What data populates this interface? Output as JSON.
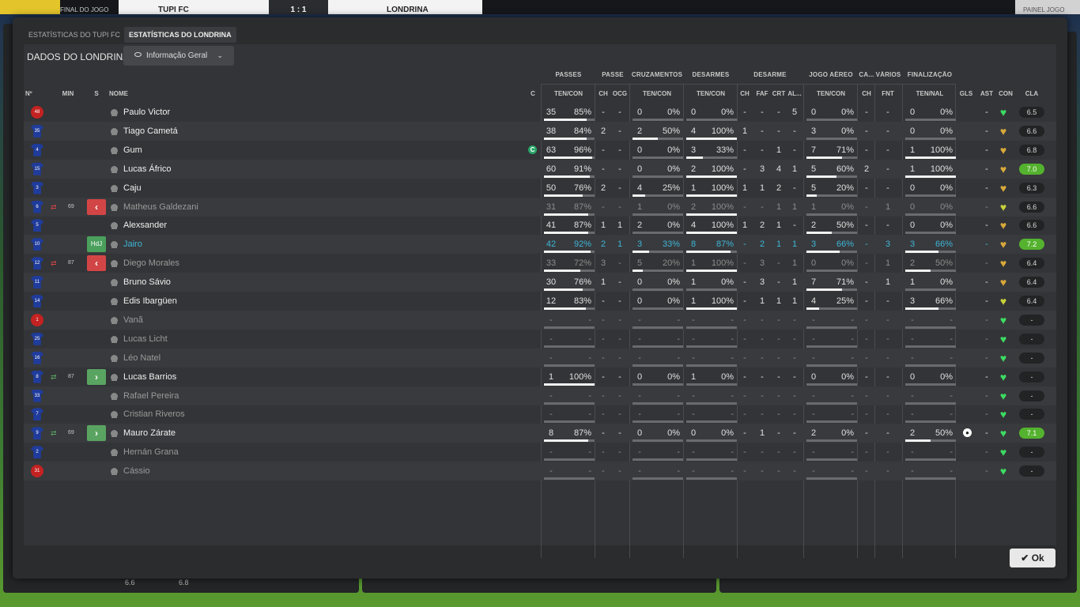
{
  "topbar": {
    "competition_label": "FINAL DO JOGO",
    "home_team": "TUPI FC",
    "score": "1 : 1",
    "away_team": "LONDRINA",
    "right_label": "PAINEL JOGO"
  },
  "tabs": [
    {
      "label": "Estatísticas do Tupi FC"
    },
    {
      "label": "Estatísticas do Londrina"
    }
  ],
  "section_title": "DADOS DO LONDRINA",
  "view_dropdown": {
    "label": "Informação Geral"
  },
  "group_headers": {
    "passes": "PASSES",
    "passe": "PASSE",
    "cruzamentos": "CRUZAMENTOS",
    "desarmes": "DESARMES",
    "desarme": "DESARME",
    "jogo_aereo": "JOGO AÉREO",
    "ca": "CA...",
    "varios": "VÁRIOS",
    "finalizacao": "FINALIZAÇÃO"
  },
  "columns": {
    "num": "Nº",
    "min": "MIN",
    "s": "S",
    "nome": "NOME",
    "c": "C",
    "passes": "TEN/CON",
    "passe_ch": "CH",
    "passe_ocg": "OCG",
    "cruz": "TEN/CON",
    "desarmes": "TEN/CON",
    "des_ch": "CH",
    "des_faf": "FAF",
    "des_crt": "CRT",
    "des_al": "AL...",
    "aereo": "TEN/CON",
    "ca_ch": "CH",
    "fnt": "FNT",
    "finalizacao": "TEN/NAL",
    "gls": "GLS",
    "ast": "AST",
    "con": "CON",
    "cla": "CLA"
  },
  "players": [
    {
      "num": "48",
      "kit": "gk",
      "sub_icon": "",
      "min": "",
      "badge": "",
      "badge_text": "",
      "name": "Paulo Victor",
      "style": "",
      "cap": "",
      "pt": "35",
      "pp": "85%",
      "pf": 0.85,
      "pch": "-",
      "ocg": "-",
      "ct": "0",
      "cp": "0%",
      "cf": 0,
      "dt": "0",
      "dp": "0%",
      "df": 0,
      "dch": "-",
      "faf": "-",
      "crt": "-",
      "al": "5",
      "at": "0",
      "ap": "0%",
      "af": 0,
      "cach": "-",
      "fnt": "-",
      "ft": "0",
      "fp": "0%",
      "ff": 0,
      "gls": "",
      "ast": "-",
      "con": "green",
      "cla": "6.5",
      "cla_style": ""
    },
    {
      "num": "35",
      "kit": "blue",
      "sub_icon": "",
      "min": "",
      "badge": "",
      "badge_text": "",
      "name": "Tiago Cametá",
      "style": "",
      "cap": "",
      "pt": "38",
      "pp": "84%",
      "pf": 0.84,
      "pch": "2",
      "ocg": "-",
      "ct": "2",
      "cp": "50%",
      "cf": 0.5,
      "dt": "4",
      "dp": "100%",
      "df": 1,
      "dch": "1",
      "faf": "-",
      "crt": "-",
      "al": "-",
      "at": "3",
      "ap": "0%",
      "af": 0,
      "cach": "-",
      "fnt": "-",
      "ft": "0",
      "fp": "0%",
      "ff": 0,
      "gls": "",
      "ast": "-",
      "con": "gold",
      "cla": "6.6",
      "cla_style": ""
    },
    {
      "num": "4",
      "kit": "blue",
      "sub_icon": "",
      "min": "",
      "badge": "",
      "badge_text": "",
      "name": "Gum",
      "style": "",
      "cap": "C",
      "pt": "63",
      "pp": "96%",
      "pf": 0.96,
      "pch": "-",
      "ocg": "-",
      "ct": "0",
      "cp": "0%",
      "cf": 0,
      "dt": "3",
      "dp": "33%",
      "df": 0.33,
      "dch": "-",
      "faf": "-",
      "crt": "1",
      "al": "-",
      "at": "7",
      "ap": "71%",
      "af": 0.71,
      "cach": "-",
      "fnt": "-",
      "ft": "1",
      "fp": "100%",
      "ff": 1,
      "gls": "",
      "ast": "-",
      "con": "gold",
      "cla": "6.8",
      "cla_style": ""
    },
    {
      "num": "15",
      "kit": "blue",
      "sub_icon": "",
      "min": "",
      "badge": "",
      "badge_text": "",
      "name": "Lucas Áfrico",
      "style": "",
      "cap": "",
      "pt": "60",
      "pp": "91%",
      "pf": 0.91,
      "pch": "-",
      "ocg": "-",
      "ct": "0",
      "cp": "0%",
      "cf": 0,
      "dt": "2",
      "dp": "100%",
      "df": 1,
      "dch": "-",
      "faf": "3",
      "crt": "4",
      "al": "1",
      "at": "5",
      "ap": "60%",
      "af": 0.6,
      "cach": "2",
      "fnt": "-",
      "ft": "1",
      "fp": "100%",
      "ff": 1,
      "gls": "",
      "ast": "-",
      "con": "gold",
      "cla": "7.0",
      "cla_style": "g"
    },
    {
      "num": "3",
      "kit": "blue",
      "sub_icon": "",
      "min": "",
      "badge": "",
      "badge_text": "",
      "name": "Caju",
      "style": "",
      "cap": "",
      "pt": "50",
      "pp": "76%",
      "pf": 0.76,
      "pch": "2",
      "ocg": "-",
      "ct": "4",
      "cp": "25%",
      "cf": 0.25,
      "dt": "1",
      "dp": "100%",
      "df": 1,
      "dch": "1",
      "faf": "1",
      "crt": "2",
      "al": "-",
      "at": "5",
      "ap": "20%",
      "af": 0.2,
      "cach": "-",
      "fnt": "-",
      "ft": "0",
      "fp": "0%",
      "ff": 0,
      "gls": "",
      "ast": "-",
      "con": "gold",
      "cla": "6.3",
      "cla_style": ""
    },
    {
      "num": "6",
      "kit": "blue",
      "sub_icon": "out",
      "min": "69",
      "badge": "out",
      "badge_text": "‹",
      "name": "Matheus Galdezani",
      "style": "dim",
      "cap": "",
      "pt": "31",
      "pp": "87%",
      "pf": 0.87,
      "pch": "-",
      "ocg": "-",
      "ct": "1",
      "cp": "0%",
      "cf": 0,
      "dt": "2",
      "dp": "100%",
      "df": 1,
      "dch": "-",
      "faf": "-",
      "crt": "1",
      "al": "1",
      "at": "1",
      "ap": "0%",
      "af": 0,
      "cach": "-",
      "fnt": "1",
      "ft": "0",
      "fp": "0%",
      "ff": 0,
      "gls": "",
      "ast": "-",
      "con": "yellow",
      "cla": "6.6",
      "cla_style": ""
    },
    {
      "num": "5",
      "kit": "blue",
      "sub_icon": "",
      "min": "",
      "badge": "",
      "badge_text": "",
      "name": "Alexsander",
      "style": "",
      "cap": "",
      "pt": "41",
      "pp": "87%",
      "pf": 0.87,
      "pch": "1",
      "ocg": "1",
      "ct": "2",
      "cp": "0%",
      "cf": 0,
      "dt": "4",
      "dp": "100%",
      "df": 1,
      "dch": "1",
      "faf": "2",
      "crt": "1",
      "al": "-",
      "at": "2",
      "ap": "50%",
      "af": 0.5,
      "cach": "-",
      "fnt": "-",
      "ft": "0",
      "fp": "0%",
      "ff": 0,
      "gls": "",
      "ast": "-",
      "con": "gold",
      "cla": "6.6",
      "cla_style": ""
    },
    {
      "num": "10",
      "kit": "blue",
      "sub_icon": "",
      "min": "",
      "badge": "hdj",
      "badge_text": "HdJ",
      "name": "Jairo",
      "style": "hl",
      "cap": "",
      "pt": "42",
      "pp": "92%",
      "pf": 0.92,
      "pch": "2",
      "ocg": "1",
      "ct": "3",
      "cp": "33%",
      "cf": 0.33,
      "dt": "8",
      "dp": "87%",
      "df": 0.87,
      "dch": "-",
      "faf": "2",
      "crt": "1",
      "al": "1",
      "at": "3",
      "ap": "66%",
      "af": 0.66,
      "cach": "-",
      "fnt": "3",
      "ft": "3",
      "fp": "66%",
      "ff": 0.66,
      "gls": "",
      "ast": "-",
      "con": "gold",
      "cla": "7.2",
      "cla_style": "g"
    },
    {
      "num": "12",
      "kit": "blue",
      "sub_icon": "out",
      "min": "87",
      "badge": "out",
      "badge_text": "‹",
      "name": "Diego Morales",
      "style": "dim",
      "cap": "",
      "pt": "33",
      "pp": "72%",
      "pf": 0.72,
      "pch": "3",
      "ocg": "-",
      "ct": "5",
      "cp": "20%",
      "cf": 0.2,
      "dt": "1",
      "dp": "100%",
      "df": 1,
      "dch": "-",
      "faf": "3",
      "crt": "-",
      "al": "1",
      "at": "0",
      "ap": "0%",
      "af": 0,
      "cach": "-",
      "fnt": "1",
      "ft": "2",
      "fp": "50%",
      "ff": 0.5,
      "gls": "",
      "ast": "-",
      "con": "gold",
      "cla": "6.4",
      "cla_style": ""
    },
    {
      "num": "11",
      "kit": "blue",
      "sub_icon": "",
      "min": "",
      "badge": "",
      "badge_text": "",
      "name": "Bruno Sávio",
      "style": "",
      "cap": "",
      "pt": "30",
      "pp": "76%",
      "pf": 0.76,
      "pch": "1",
      "ocg": "-",
      "ct": "0",
      "cp": "0%",
      "cf": 0,
      "dt": "1",
      "dp": "0%",
      "df": 0,
      "dch": "-",
      "faf": "3",
      "crt": "-",
      "al": "1",
      "at": "7",
      "ap": "71%",
      "af": 0.71,
      "cach": "-",
      "fnt": "1",
      "ft": "1",
      "fp": "0%",
      "ff": 0,
      "gls": "",
      "ast": "-",
      "con": "gold",
      "cla": "6.4",
      "cla_style": ""
    },
    {
      "num": "14",
      "kit": "blue",
      "sub_icon": "",
      "min": "",
      "badge": "",
      "badge_text": "",
      "name": "Edis Ibargüen",
      "style": "",
      "cap": "",
      "pt": "12",
      "pp": "83%",
      "pf": 0.83,
      "pch": "-",
      "ocg": "-",
      "ct": "0",
      "cp": "0%",
      "cf": 0,
      "dt": "1",
      "dp": "100%",
      "df": 1,
      "dch": "-",
      "faf": "1",
      "crt": "1",
      "al": "1",
      "at": "4",
      "ap": "25%",
      "af": 0.25,
      "cach": "-",
      "fnt": "-",
      "ft": "3",
      "fp": "66%",
      "ff": 0.66,
      "gls": "",
      "ast": "-",
      "con": "yellow",
      "cla": "6.4",
      "cla_style": ""
    },
    {
      "num": "1",
      "kit": "gk",
      "sub_icon": "",
      "min": "",
      "badge": "",
      "badge_text": "",
      "name": "Vanã",
      "style": "dim",
      "cap": "",
      "pt": "-",
      "pp": "-",
      "pf": 0,
      "pch": "-",
      "ocg": "-",
      "ct": "-",
      "cp": "-",
      "cf": 0,
      "dt": "-",
      "dp": "-",
      "df": 0,
      "dch": "-",
      "faf": "-",
      "crt": "-",
      "al": "-",
      "at": "-",
      "ap": "-",
      "af": 0,
      "cach": "-",
      "fnt": "-",
      "ft": "-",
      "fp": "-",
      "ff": 0,
      "gls": "",
      "ast": "-",
      "con": "green",
      "cla": "-",
      "cla_style": ""
    },
    {
      "num": "25",
      "kit": "blue",
      "sub_icon": "",
      "min": "",
      "badge": "",
      "badge_text": "",
      "name": "Lucas Licht",
      "style": "dim",
      "cap": "",
      "pt": "-",
      "pp": "-",
      "pf": 0,
      "pch": "-",
      "ocg": "-",
      "ct": "-",
      "cp": "-",
      "cf": 0,
      "dt": "-",
      "dp": "-",
      "df": 0,
      "dch": "-",
      "faf": "-",
      "crt": "-",
      "al": "-",
      "at": "-",
      "ap": "-",
      "af": 0,
      "cach": "-",
      "fnt": "-",
      "ft": "-",
      "fp": "-",
      "ff": 0,
      "gls": "",
      "ast": "-",
      "con": "green",
      "cla": "-",
      "cla_style": ""
    },
    {
      "num": "16",
      "kit": "blue",
      "sub_icon": "",
      "min": "",
      "badge": "",
      "badge_text": "",
      "name": "Léo Natel",
      "style": "dim",
      "cap": "",
      "pt": "-",
      "pp": "-",
      "pf": 0,
      "pch": "-",
      "ocg": "-",
      "ct": "-",
      "cp": "-",
      "cf": 0,
      "dt": "-",
      "dp": "-",
      "df": 0,
      "dch": "-",
      "faf": "-",
      "crt": "-",
      "al": "-",
      "at": "-",
      "ap": "-",
      "af": 0,
      "cach": "-",
      "fnt": "-",
      "ft": "-",
      "fp": "-",
      "ff": 0,
      "gls": "",
      "ast": "-",
      "con": "green",
      "cla": "-",
      "cla_style": ""
    },
    {
      "num": "8",
      "kit": "blue",
      "sub_icon": "in",
      "min": "87",
      "badge": "in",
      "badge_text": "›",
      "name": "Lucas Barrios",
      "style": "",
      "cap": "",
      "pt": "1",
      "pp": "100%",
      "pf": 1,
      "pch": "-",
      "ocg": "-",
      "ct": "0",
      "cp": "0%",
      "cf": 0,
      "dt": "1",
      "dp": "0%",
      "df": 0,
      "dch": "-",
      "faf": "-",
      "crt": "-",
      "al": "-",
      "at": "0",
      "ap": "0%",
      "af": 0,
      "cach": "-",
      "fnt": "-",
      "ft": "0",
      "fp": "0%",
      "ff": 0,
      "gls": "",
      "ast": "-",
      "con": "green",
      "cla": "-",
      "cla_style": ""
    },
    {
      "num": "33",
      "kit": "blue",
      "sub_icon": "",
      "min": "",
      "badge": "",
      "badge_text": "",
      "name": "Rafael Pereira",
      "style": "dim",
      "cap": "",
      "pt": "-",
      "pp": "-",
      "pf": 0,
      "pch": "-",
      "ocg": "-",
      "ct": "-",
      "cp": "-",
      "cf": 0,
      "dt": "-",
      "dp": "-",
      "df": 0,
      "dch": "-",
      "faf": "-",
      "crt": "-",
      "al": "-",
      "at": "-",
      "ap": "-",
      "af": 0,
      "cach": "-",
      "fnt": "-",
      "ft": "-",
      "fp": "-",
      "ff": 0,
      "gls": "",
      "ast": "-",
      "con": "green",
      "cla": "-",
      "cla_style": ""
    },
    {
      "num": "7",
      "kit": "blue",
      "sub_icon": "",
      "min": "",
      "badge": "",
      "badge_text": "",
      "name": "Cristian Riveros",
      "style": "dim",
      "cap": "",
      "pt": "-",
      "pp": "-",
      "pf": 0,
      "pch": "-",
      "ocg": "-",
      "ct": "-",
      "cp": "-",
      "cf": 0,
      "dt": "-",
      "dp": "-",
      "df": 0,
      "dch": "-",
      "faf": "-",
      "crt": "-",
      "al": "-",
      "at": "-",
      "ap": "-",
      "af": 0,
      "cach": "-",
      "fnt": "-",
      "ft": "-",
      "fp": "-",
      "ff": 0,
      "gls": "",
      "ast": "-",
      "con": "green",
      "cla": "-",
      "cla_style": ""
    },
    {
      "num": "9",
      "kit": "blue",
      "sub_icon": "in",
      "min": "69",
      "badge": "in",
      "badge_text": "›",
      "name": "Mauro Zárate",
      "style": "",
      "cap": "",
      "pt": "8",
      "pp": "87%",
      "pf": 0.87,
      "pch": "-",
      "ocg": "-",
      "ct": "0",
      "cp": "0%",
      "cf": 0,
      "dt": "0",
      "dp": "0%",
      "df": 0,
      "dch": "-",
      "faf": "1",
      "crt": "-",
      "al": "-",
      "at": "2",
      "ap": "0%",
      "af": 0,
      "cach": "-",
      "fnt": "-",
      "ft": "2",
      "fp": "50%",
      "ff": 0.5,
      "gls": "ball",
      "ast": "-",
      "con": "green",
      "cla": "7.1",
      "cla_style": "g"
    },
    {
      "num": "2",
      "kit": "blue",
      "sub_icon": "",
      "min": "",
      "badge": "",
      "badge_text": "",
      "name": "Hernán Grana",
      "style": "dim",
      "cap": "",
      "pt": "-",
      "pp": "-",
      "pf": 0,
      "pch": "-",
      "ocg": "-",
      "ct": "-",
      "cp": "-",
      "cf": 0,
      "dt": "-",
      "dp": "-",
      "df": 0,
      "dch": "-",
      "faf": "-",
      "crt": "-",
      "al": "-",
      "at": "-",
      "ap": "-",
      "af": 0,
      "cach": "-",
      "fnt": "-",
      "ft": "-",
      "fp": "-",
      "ff": 0,
      "gls": "",
      "ast": "-",
      "con": "green",
      "cla": "-",
      "cla_style": ""
    },
    {
      "num": "31",
      "kit": "gk",
      "sub_icon": "",
      "min": "",
      "badge": "",
      "badge_text": "",
      "name": "Cássio",
      "style": "dim",
      "cap": "",
      "pt": "-",
      "pp": "-",
      "pf": 0,
      "pch": "-",
      "ocg": "-",
      "ct": "-",
      "cp": "-",
      "cf": 0,
      "dt": "-",
      "dp": "-",
      "df": 0,
      "dch": "-",
      "faf": "-",
      "crt": "-",
      "al": "-",
      "at": "-",
      "ap": "-",
      "af": 0,
      "cach": "-",
      "fnt": "-",
      "ft": "-",
      "fp": "-",
      "ff": 0,
      "gls": "",
      "ast": "-",
      "con": "green",
      "cla": "-",
      "cla_style": ""
    }
  ],
  "bottom": {
    "left_value": "6.6",
    "right_value": "6.8"
  },
  "ok_button": {
    "label": "Ok"
  },
  "colors": {
    "heart_green": "#3ddc62",
    "heart_gold": "#d9a93a",
    "heart_yellow": "#c8d23a",
    "rating_green": "#54b22e",
    "sub_out": "#d24546",
    "sub_in": "#5aa462",
    "highlight": "#3fb6d8"
  }
}
